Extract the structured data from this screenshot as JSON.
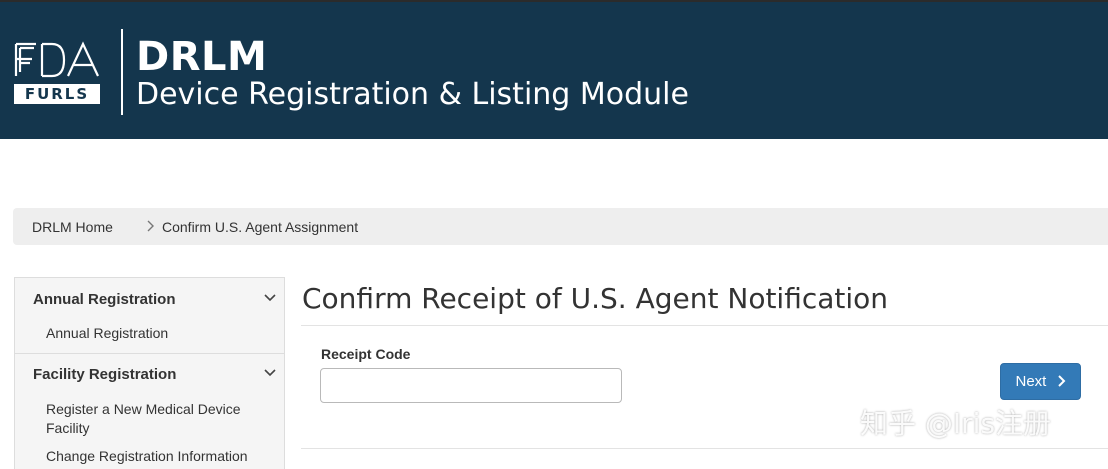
{
  "header": {
    "logo_top": "FDA",
    "logo_bottom": "FURLS",
    "app_short": "DRLM",
    "app_long": "Device Registration & Listing Module"
  },
  "breadcrumb": {
    "home": "DRLM Home",
    "separator": ">",
    "current": "Confirm U.S. Agent Assignment"
  },
  "sidebar": {
    "sections": [
      {
        "title": "Annual Registration",
        "items": [
          "Annual Registration"
        ]
      },
      {
        "title": "Facility Registration",
        "items": [
          "Register a New Medical Device Facility",
          "Change Registration Information"
        ]
      }
    ]
  },
  "main": {
    "title": "Confirm Receipt of U.S. Agent Notification",
    "receipt_label": "Receipt Code",
    "receipt_value": "",
    "next_label": "Next",
    "next_icon": "chevron-right-icon"
  },
  "watermark": "知乎 @Iris注册",
  "colors": {
    "header_bg": "#14364d",
    "button_bg": "#337ab7",
    "breadcrumb_bg": "#eeeeee",
    "sidebar_bg": "#f5f5f5"
  }
}
